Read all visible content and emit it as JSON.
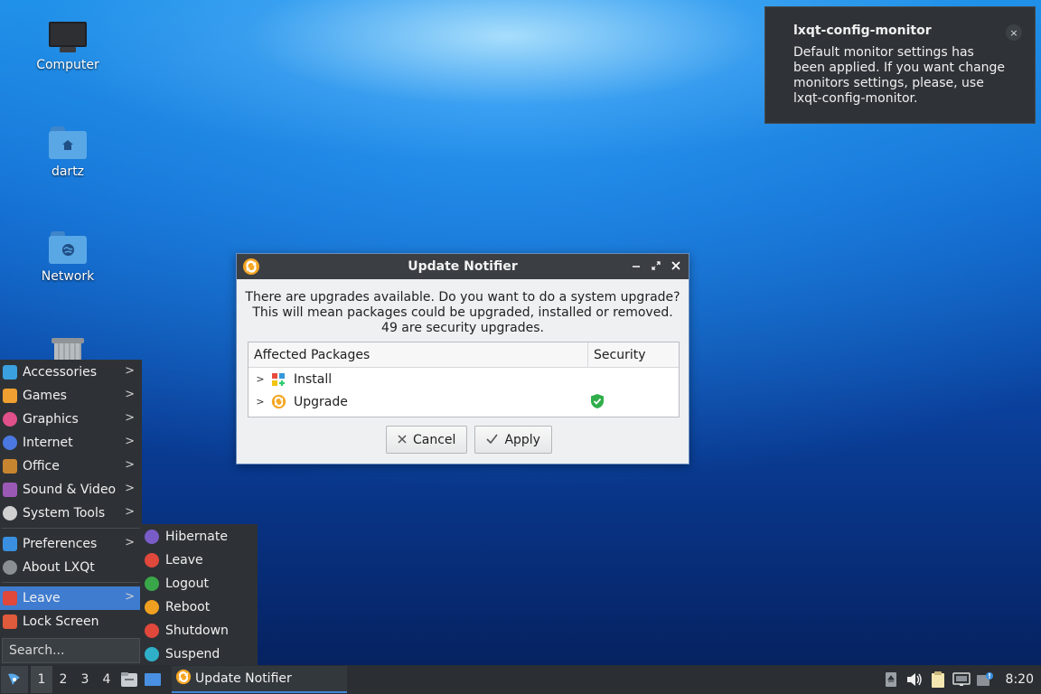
{
  "desktop": {
    "icons": [
      {
        "label": "Computer"
      },
      {
        "label": "dartz"
      },
      {
        "label": "Network"
      },
      {
        "label": ""
      }
    ]
  },
  "notification": {
    "title": "lxqt-config-monitor",
    "body": "Default monitor settings has been applied. If you want change monitors settings, please, use lxqt-config-monitor.",
    "close_glyph": "×"
  },
  "dialog": {
    "title": "Update Notifier",
    "message_lines": [
      "There are upgrades available. Do you want to do a system upgrade?",
      "This will mean packages could be upgraded, installed or removed.",
      "49 are security upgrades."
    ],
    "columns": [
      "Affected Packages",
      "Security"
    ],
    "rows": [
      {
        "label": "Install",
        "icon": "install-icon",
        "security": ""
      },
      {
        "label": "Upgrade",
        "icon": "upgrade-icon",
        "security": "shield-check-icon"
      }
    ],
    "cancel_label": "Cancel",
    "apply_label": "Apply",
    "window_buttons": [
      "minimize",
      "maximize",
      "close"
    ]
  },
  "menu": {
    "categories": [
      {
        "label": "Accessories",
        "color": "#3aa0e0"
      },
      {
        "label": "Games",
        "color": "#f0a030"
      },
      {
        "label": "Graphics",
        "color": "#e0508a"
      },
      {
        "label": "Internet",
        "color": "#4a78e0"
      },
      {
        "label": "Office",
        "color": "#c8852f"
      },
      {
        "label": "Sound & Video",
        "color": "#9b59b6"
      },
      {
        "label": "System Tools",
        "color": "#d0d0d0"
      }
    ],
    "settings": [
      {
        "label": "Preferences",
        "color": "#3a8fe0"
      },
      {
        "label": "About LXQt",
        "color": "#8a8f94"
      }
    ],
    "leave_label": "Leave",
    "lock_label": "Lock Screen",
    "search_placeholder": "Search..."
  },
  "leave_submenu": {
    "items": [
      {
        "label": "Hibernate",
        "color": "#7a5cc8"
      },
      {
        "label": "Leave",
        "color": "#e0483c"
      },
      {
        "label": "Logout",
        "color": "#3aa64a"
      },
      {
        "label": "Reboot",
        "color": "#f0a020"
      },
      {
        "label": "Shutdown",
        "color": "#e0483c"
      },
      {
        "label": "Suspend",
        "color": "#2fb0c8"
      }
    ]
  },
  "taskbar": {
    "desktops": [
      "1",
      "2",
      "3",
      "4"
    ],
    "current_desktop": "1",
    "task_label": "Update Notifier",
    "clock": "8:20"
  }
}
